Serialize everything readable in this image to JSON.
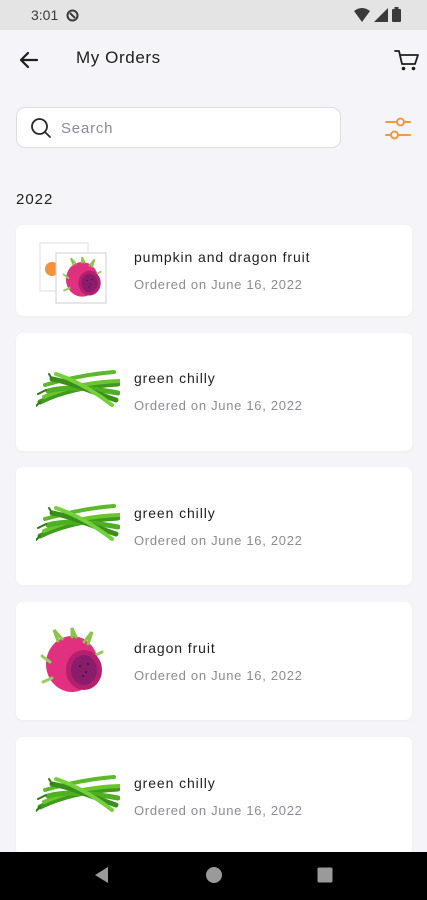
{
  "status_bar": {
    "time": "3:01",
    "icons": [
      "sync-icon",
      "wifi-icon",
      "signal-icon",
      "battery-icon"
    ]
  },
  "header": {
    "title": "My Orders",
    "back_icon": "arrow-left-icon",
    "cart_icon": "shopping-cart-icon"
  },
  "search": {
    "placeholder": "Search",
    "value": "",
    "icon": "search-icon"
  },
  "filter": {
    "icon": "sliders-icon"
  },
  "colors": {
    "accent": "#f29a3a",
    "background": "#f5f5f9",
    "card": "#ffffff",
    "text": "#1e1e1e",
    "muted": "#8b8b96"
  },
  "group": {
    "year": "2022"
  },
  "orders": [
    {
      "name": "pumpkin and dragon fruit",
      "date": "Ordered on June 16, 2022",
      "image": "pumpkin-dragon-fruit-thumb"
    },
    {
      "name": "green chilly",
      "date": "Ordered on June 16, 2022",
      "image": "green-chilly-thumb"
    },
    {
      "name": "green chilly",
      "date": "Ordered on June 16, 2022",
      "image": "green-chilly-thumb"
    },
    {
      "name": "dragon fruit",
      "date": "Ordered on June 16, 2022",
      "image": "dragon-fruit-thumb"
    },
    {
      "name": "green chilly",
      "date": "Ordered on June 16, 2022",
      "image": "green-chilly-thumb"
    }
  ],
  "nav_bar": {
    "icons": [
      "back-triangle-icon",
      "home-circle-icon",
      "recents-square-icon"
    ]
  }
}
